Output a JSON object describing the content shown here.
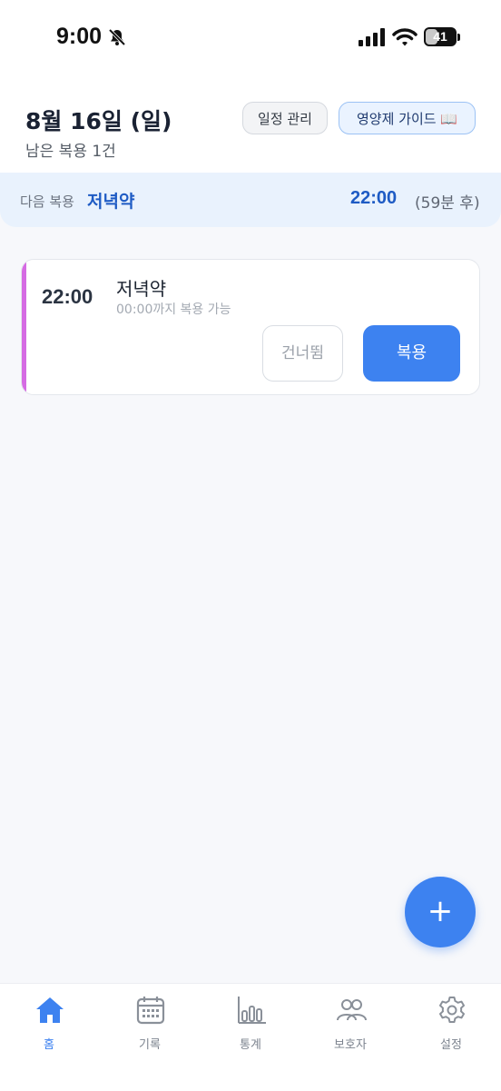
{
  "status_bar": {
    "time": "9:00",
    "battery": "41",
    "battery_fraction": 0.41
  },
  "header": {
    "date": "8월 16일 (일)",
    "remaining": "남은 복용 1건",
    "schedule_button": "일정 관리",
    "guide_button": "영양제 가이드 📖"
  },
  "next_dose": {
    "label": "다음 복용",
    "name": "저녁약",
    "time": "22:00",
    "remaining": "(59분 후)"
  },
  "doses": [
    {
      "time": "22:00",
      "name": "저녁약",
      "window": "00:00까지 복용 가능",
      "skip_label": "건너뜀",
      "take_label": "복용",
      "accent": "#d56be3"
    }
  ],
  "fab": {
    "label": "+"
  },
  "tabs": [
    {
      "label": "홈",
      "icon": "home-icon",
      "active": true
    },
    {
      "label": "기록",
      "icon": "calendar-icon",
      "active": false
    },
    {
      "label": "통계",
      "icon": "bar-chart-icon",
      "active": false
    },
    {
      "label": "보호자",
      "icon": "people-icon",
      "active": false
    },
    {
      "label": "설정",
      "icon": "gear-icon",
      "active": false
    }
  ],
  "colors": {
    "accent": "#3d82f0",
    "next_text": "#1e5bc4",
    "banner_bg": "#e9f2fd"
  }
}
